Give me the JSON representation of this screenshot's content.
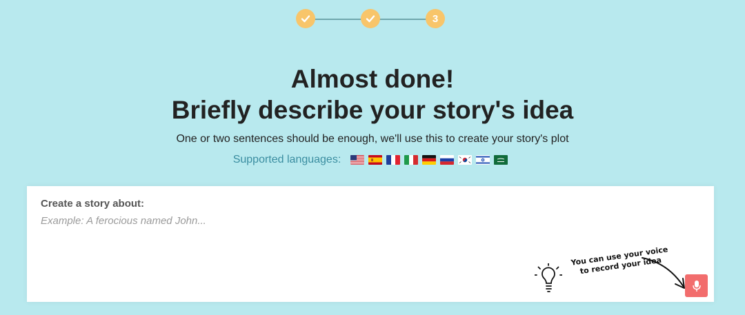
{
  "stepper": {
    "steps": [
      {
        "state": "done"
      },
      {
        "state": "done"
      },
      {
        "state": "current",
        "label": "3"
      }
    ],
    "color": "#f8c56a"
  },
  "headline": {
    "line1": "Almost done!",
    "line2": "Briefly describe your story's idea"
  },
  "subtitle": "One or two sentences should be enough, we'll use this to create your story's plot",
  "languages": {
    "label": "Supported languages:",
    "flags": [
      "us-flag",
      "spain-flag",
      "france-flag",
      "italy-flag",
      "germany-flag",
      "russia-flag",
      "south-korea-flag",
      "israel-flag",
      "saudi-arabia-flag"
    ]
  },
  "form": {
    "label": "Create a story about:",
    "placeholder": "Example: A ferocious named John...",
    "value": ""
  },
  "voice_hint": {
    "line1": "You can use your voice",
    "line2": "to record your idea"
  },
  "mic_button": {
    "icon": "microphone-icon",
    "color": "#f26d6d"
  }
}
